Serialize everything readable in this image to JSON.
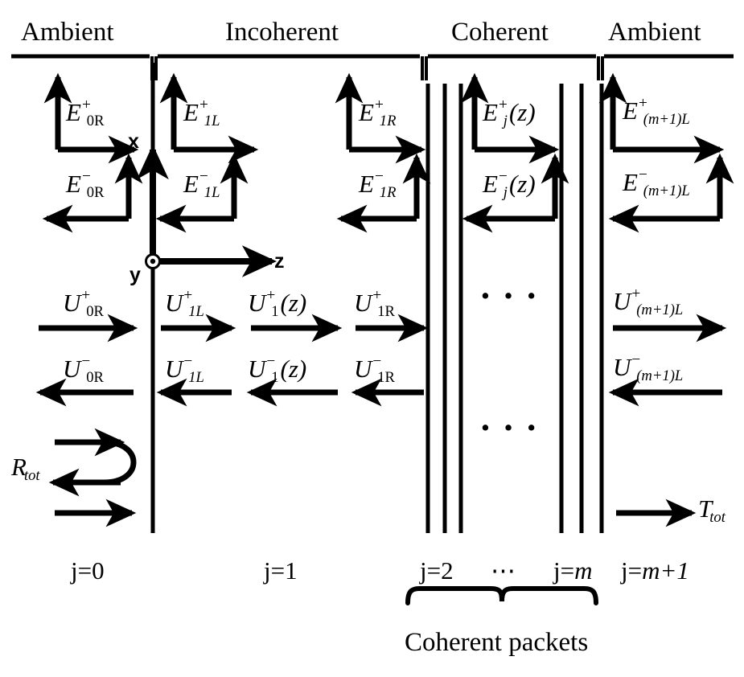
{
  "figure": {
    "title": "Optical multilayer stack: coherent and incoherent layer field amplitudes",
    "background_color": "#ffffff",
    "line_color": "#000000"
  },
  "section_headers": [
    {
      "id": "ambient-left",
      "label": "Ambient"
    },
    {
      "id": "incoherent",
      "label": "Incoherent"
    },
    {
      "id": "coherent",
      "label": "Coherent"
    },
    {
      "id": "ambient-right",
      "label": "Ambient"
    }
  ],
  "axes": {
    "x_label": "x",
    "y_label": "y",
    "z_label": "z",
    "y_marker": "dot-in-circle"
  },
  "field_labels": [
    {
      "id": "E0R-plus",
      "base": "E",
      "sup": "+",
      "sub": "0R",
      "sub_style": "upright",
      "arg": ""
    },
    {
      "id": "E0R-minus",
      "base": "E",
      "sup": "−",
      "sub": "0R",
      "sub_style": "upright",
      "arg": ""
    },
    {
      "id": "E1L-plus",
      "base": "E",
      "sup": "+",
      "sub": "1L",
      "sub_style": "italic",
      "arg": ""
    },
    {
      "id": "E1L-minus",
      "base": "E",
      "sup": "−",
      "sub": "1L",
      "sub_style": "italic",
      "arg": ""
    },
    {
      "id": "E1R-plus",
      "base": "E",
      "sup": "+",
      "sub": "1R",
      "sub_style": "italic",
      "arg": ""
    },
    {
      "id": "E1R-minus",
      "base": "E",
      "sup": "−",
      "sub": "1R",
      "sub_style": "italic",
      "arg": ""
    },
    {
      "id": "Ej-plus",
      "base": "E",
      "sup": "+",
      "sub": "j",
      "sub_style": "italic",
      "arg": "(z)"
    },
    {
      "id": "Ej-minus",
      "base": "E",
      "sup": "−",
      "sub": "j",
      "sub_style": "italic",
      "arg": "(z)"
    },
    {
      "id": "Em1L-plus",
      "base": "E",
      "sup": "+",
      "sub": "(m+1)L",
      "sub_style": "italic",
      "arg": ""
    },
    {
      "id": "Em1L-minus",
      "base": "E",
      "sup": "−",
      "sub": "(m+1)L",
      "sub_style": "italic",
      "arg": ""
    }
  ],
  "intensity_labels": [
    {
      "id": "U0R-plus",
      "base": "U",
      "sup": "+",
      "sub": "0R",
      "sub_style": "upright",
      "arg": ""
    },
    {
      "id": "U0R-minus",
      "base": "U",
      "sup": "−",
      "sub": "0R",
      "sub_style": "upright",
      "arg": ""
    },
    {
      "id": "U1L-plus",
      "base": "U",
      "sup": "+",
      "sub": "1L",
      "sub_style": "italic",
      "arg": ""
    },
    {
      "id": "U1L-minus",
      "base": "U",
      "sup": "−",
      "sub": "1L",
      "sub_style": "italic",
      "arg": ""
    },
    {
      "id": "U1z-plus",
      "base": "U",
      "sup": "+",
      "sub": "1",
      "sub_style": "upright",
      "arg": "(z)"
    },
    {
      "id": "U1z-minus",
      "base": "U",
      "sup": "−",
      "sub": "1",
      "sub_style": "upright",
      "arg": "(z)"
    },
    {
      "id": "U1R-plus",
      "base": "U",
      "sup": "+",
      "sub": "1R",
      "sub_style": "upright",
      "arg": ""
    },
    {
      "id": "U1R-minus",
      "base": "U",
      "sup": "−",
      "sub": "1R",
      "sub_style": "upright",
      "arg": ""
    },
    {
      "id": "Um1L-plus",
      "base": "U",
      "sup": "+",
      "sub": "(m+1)L",
      "sub_style": "italic",
      "arg": ""
    },
    {
      "id": "Um1L-minus",
      "base": "U",
      "sup": "−",
      "sub": "(m+1)L",
      "sub_style": "italic",
      "arg": ""
    }
  ],
  "totals": {
    "reflectance": {
      "base": "R",
      "sub": "tot"
    },
    "transmittance": {
      "base": "T",
      "sub": "tot"
    }
  },
  "layer_indices": [
    {
      "id": "j0",
      "prefix": "j=",
      "value": "0",
      "italic_value": false
    },
    {
      "id": "j1",
      "prefix": "j=",
      "value": "1",
      "italic_value": false
    },
    {
      "id": "j2",
      "prefix": "j=",
      "value": "2",
      "italic_value": false
    },
    {
      "id": "jdots",
      "prefix": "",
      "value": "⋯",
      "italic_value": false
    },
    {
      "id": "jm",
      "prefix": "j=",
      "value": "m",
      "italic_value": true
    },
    {
      "id": "jm1",
      "prefix": "j=",
      "value": "m+1",
      "italic_value": true
    }
  ],
  "ellipsis": {
    "upper": "•  •  •",
    "lower": "•  •  •"
  },
  "brace_caption": "Coherent packets"
}
